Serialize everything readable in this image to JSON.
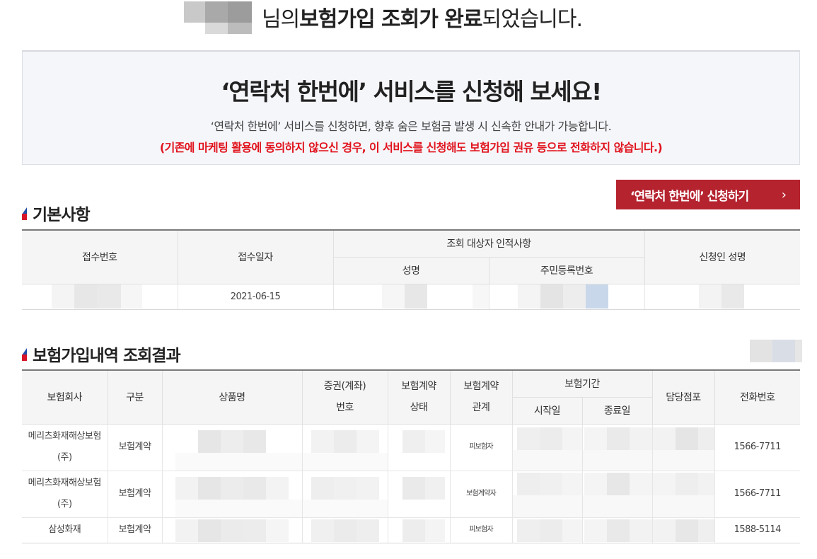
{
  "header": {
    "suffix_light1": "님의 ",
    "bold1": "보험가입 조회가 완료",
    "suffix_light2": "되었습니다."
  },
  "notice": {
    "title": "‘연락처 한번에’ 서비스를 신청해 보세요!",
    "description": "‘연락처 한번에’ 서비스를 신청하면, 향후 숨은 보험금 발생 시 신속한 안내가 가능합니다.",
    "warning": "(기존에 마케팅 활용에 동의하지 않으신 경우, 이 서비스를 신청해도 보험가입 권유 등으로 전화하지 않습니다.)"
  },
  "apply_button": {
    "label": "‘연락처 한번에’ 신청하기",
    "chevron": "›"
  },
  "basic": {
    "title": "기본사항",
    "headers": {
      "receipt_no": "접수번호",
      "receipt_date": "접수일자",
      "target_info": "조회 대상자 인적사항",
      "name": "성명",
      "resident_no": "주민등록번호",
      "applicant_name": "신청인 성명"
    },
    "row": {
      "receipt_date": "2021-06-15"
    }
  },
  "results": {
    "title": "보험가입내역 조회결과",
    "headers": {
      "company": "보험회사",
      "category": "구분",
      "product": "상품명",
      "policy_line1": "증권(계좌)",
      "policy_line2": "번호",
      "status_line1": "보험계약",
      "status_line2": "상태",
      "relation_line1": "보험계약",
      "relation_line2": "관계",
      "period": "보험기간",
      "start": "시작일",
      "end": "종료일",
      "branch": "담당점포",
      "phone": "전화번호"
    },
    "rows": [
      {
        "company_line1": "메리츠화재해상보험",
        "company_line2": "(주)",
        "category": "보험계약",
        "relation": "피보험자",
        "phone": "1566-7711"
      },
      {
        "company_line1": "메리츠화재해상보험",
        "company_line2": "(주)",
        "category": "보험계약",
        "relation": "보험계약자",
        "phone": "1566-7711"
      },
      {
        "company_line1": "삼성화재",
        "company_line2": "",
        "category": "보험계약",
        "relation": "피보험자",
        "phone": "1588-5114"
      }
    ]
  }
}
